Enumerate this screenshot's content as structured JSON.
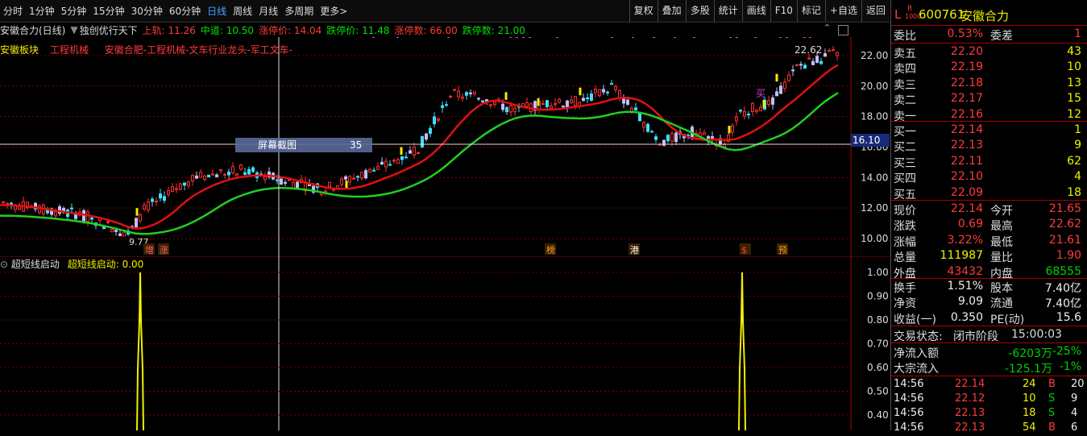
{
  "periods": [
    "分时",
    "1分钟",
    "5分钟",
    "15分钟",
    "30分钟",
    "60分钟",
    "日线",
    "周线",
    "月线",
    "多周期",
    "更多>"
  ],
  "active_period": "日线",
  "tools": [
    "复权",
    "叠加",
    "多股",
    "统计",
    "画线",
    "F10",
    "标记",
    "+自选",
    "返回"
  ],
  "info": {
    "stock": "安徽合力(日线)",
    "indicator": "独创优行天下",
    "upper": "上轨: 11.26",
    "mid": "中道: 10.50",
    "limit_up_price": "涨停价: 14.04",
    "limit_down_price": "跌停价: 11.48",
    "limit_up_count": "涨停数: 66.00",
    "limit_down_count": "跌停数: 21.00"
  },
  "sector": {
    "label": "安徽板块",
    "industry": "工程机械",
    "tags": "安徽合肥-工程机械-文车行业龙头-军工文车-"
  },
  "price_axis": [
    "22.00",
    "20.00",
    "18.00",
    "16.00",
    "14.00",
    "12.00",
    "10.00"
  ],
  "crosshair_price": "16.10",
  "screenshot_tip": {
    "label": "屏幕截图",
    "value": "35"
  },
  "high_label": "22.62",
  "low_label": "9.77",
  "markers": [
    "增",
    "涨",
    "榜",
    "港",
    "$",
    "预"
  ],
  "buy_marker": "买",
  "indicator_panel": {
    "name": "超短线启动",
    "value_label": "超短线启动: 0.00",
    "axis": [
      "1.00",
      "0.90",
      "0.80",
      "0.70",
      "0.60",
      "0.50",
      "0.40"
    ]
  },
  "quote": {
    "code": "600761",
    "name": "安徽合力",
    "flag1": "L",
    "flag2": "R",
    "flag3": "1000",
    "weibi_label": "委比",
    "weibi": "0.53%",
    "weicha_label": "委差",
    "weicha": "1",
    "asks": [
      {
        "label": "卖五",
        "price": "22.20",
        "vol": "43"
      },
      {
        "label": "卖四",
        "price": "22.19",
        "vol": "10"
      },
      {
        "label": "卖三",
        "price": "22.18",
        "vol": "13"
      },
      {
        "label": "卖二",
        "price": "22.17",
        "vol": "15"
      },
      {
        "label": "卖一",
        "price": "22.16",
        "vol": "12"
      }
    ],
    "bids": [
      {
        "label": "买一",
        "price": "22.14",
        "vol": "1"
      },
      {
        "label": "买二",
        "price": "22.13",
        "vol": "9"
      },
      {
        "label": "买三",
        "price": "22.11",
        "vol": "62"
      },
      {
        "label": "买四",
        "price": "22.10",
        "vol": "4"
      },
      {
        "label": "买五",
        "price": "22.09",
        "vol": "18"
      }
    ],
    "stats": [
      {
        "l1": "现价",
        "v1": "22.14",
        "c1": "red",
        "l2": "今开",
        "v2": "21.65",
        "c2": "red"
      },
      {
        "l1": "涨跌",
        "v1": "0.69",
        "c1": "red",
        "l2": "最高",
        "v2": "22.62",
        "c2": "red"
      },
      {
        "l1": "涨幅",
        "v1": "3.22%",
        "c1": "red",
        "l2": "最低",
        "v2": "21.61",
        "c2": "red"
      },
      {
        "l1": "总量",
        "v1": "111987",
        "c1": "yellow",
        "l2": "量比",
        "v2": "1.90",
        "c2": "red"
      },
      {
        "l1": "外盘",
        "v1": "43432",
        "c1": "red",
        "l2": "内盘",
        "v2": "68555",
        "c2": "green"
      }
    ],
    "stats2": [
      {
        "l1": "换手",
        "v1": "1.51%",
        "l2": "股本",
        "v2": "7.40亿"
      },
      {
        "l1": "净资",
        "v1": "9.09",
        "l2": "流通",
        "v2": "7.40亿"
      },
      {
        "l1": "收益(一)",
        "v1": "0.350",
        "l2": "PE(动)",
        "v2": "15.6"
      }
    ],
    "status_label": "交易状态:",
    "status": "闭市阶段",
    "status_time": "15:00:03",
    "netflow_label": "净流入额",
    "netflow": "-6203万",
    "netflow_pct": "-25%",
    "block_label": "大宗流入",
    "block": "-125.1万",
    "block_pct": "-1%",
    "ticks": [
      {
        "time": "14:56",
        "price": "22.14",
        "vol": "24",
        "side": "B",
        "n": "20"
      },
      {
        "time": "14:56",
        "price": "22.12",
        "vol": "10",
        "side": "S",
        "n": "9"
      },
      {
        "time": "14:56",
        "price": "22.13",
        "vol": "18",
        "side": "S",
        "n": "4"
      },
      {
        "time": "14:56",
        "price": "22.13",
        "vol": "54",
        "side": "B",
        "n": "6"
      }
    ]
  }
}
